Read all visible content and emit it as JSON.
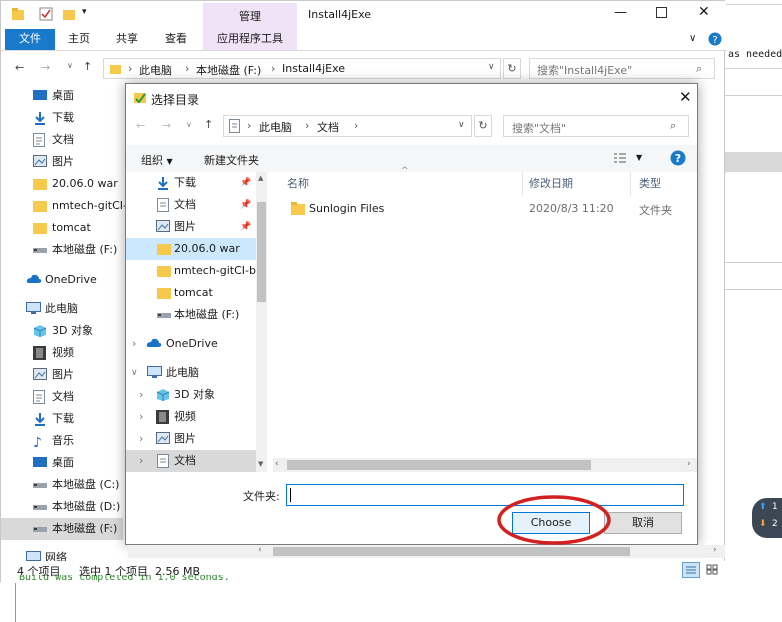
{
  "explorer": {
    "window_title": "Install4jExe",
    "context_tab_group": "管理",
    "ribbon_tabs": [
      "文件",
      "主页",
      "共享",
      "查看",
      "应用程序工具"
    ],
    "address_path": [
      "此电脑",
      "本地磁盘 (F:)",
      "Install4jExe"
    ],
    "search_placeholder": "搜索\"Install4jExe\"",
    "nav_items": [
      {
        "label": "桌面",
        "icon": "desktop-icon"
      },
      {
        "label": "下载",
        "icon": "download-icon"
      },
      {
        "label": "文档",
        "icon": "document-icon"
      },
      {
        "label": "图片",
        "icon": "pictures-icon"
      },
      {
        "label": "20.06.0 war",
        "icon": "folder-icon"
      },
      {
        "label": "nmtech-gitCI-",
        "icon": "folder-icon"
      },
      {
        "label": "tomcat",
        "icon": "folder-icon"
      },
      {
        "label": "本地磁盘 (F:)",
        "icon": "drive-icon"
      },
      {
        "label": "OneDrive",
        "icon": "cloud-icon"
      },
      {
        "label": "此电脑",
        "icon": "computer-icon"
      },
      {
        "label": "3D 对象",
        "icon": "cube-icon"
      },
      {
        "label": "视频",
        "icon": "video-icon"
      },
      {
        "label": "图片",
        "icon": "pictures-icon"
      },
      {
        "label": "文档",
        "icon": "document-icon"
      },
      {
        "label": "下载",
        "icon": "download-icon"
      },
      {
        "label": "音乐",
        "icon": "music-icon"
      },
      {
        "label": "桌面",
        "icon": "desktop-icon"
      },
      {
        "label": "本地磁盘 (C:)",
        "icon": "drive-icon"
      },
      {
        "label": "本地磁盘 (D:)",
        "icon": "drive-icon"
      },
      {
        "label": "本地磁盘 (F:)",
        "icon": "drive-icon"
      },
      {
        "label": "网络",
        "icon": "network-icon"
      }
    ],
    "status_count": "4 个项目",
    "status_selected": "选中 1 个项目  2.56 MB"
  },
  "background": {
    "right_text": "as needed.",
    "bottom_text": "Build was completed in 1.0 seconds.",
    "badge_up": "1",
    "badge_down": "2"
  },
  "dialog": {
    "title": "选择目录",
    "address_path": [
      "此电脑",
      "文档"
    ],
    "search_placeholder": "搜索\"文档\"",
    "organize_label": "组织",
    "new_folder_label": "新建文件夹",
    "nav_items": [
      {
        "label": "下载",
        "icon": "download-icon"
      },
      {
        "label": "文档",
        "icon": "document-icon"
      },
      {
        "label": "图片",
        "icon": "pictures-icon"
      },
      {
        "label": "20.06.0 war",
        "icon": "folder-icon"
      },
      {
        "label": "nmtech-gitCI-b",
        "icon": "folder-icon"
      },
      {
        "label": "tomcat",
        "icon": "folder-icon"
      },
      {
        "label": "本地磁盘 (F:)",
        "icon": "drive-icon"
      },
      {
        "label": "OneDrive",
        "icon": "cloud-icon"
      },
      {
        "label": "此电脑",
        "icon": "computer-icon"
      },
      {
        "label": "3D 对象",
        "icon": "cube-icon"
      },
      {
        "label": "视频",
        "icon": "video-icon"
      },
      {
        "label": "图片",
        "icon": "pictures-icon"
      },
      {
        "label": "文档",
        "icon": "document-icon"
      }
    ],
    "columns": {
      "name": "名称",
      "date": "修改日期",
      "type": "类型"
    },
    "files": [
      {
        "name": "Sunlogin Files",
        "date": "2020/8/3 11:20",
        "type": "文件夹"
      }
    ],
    "filename_label": "文件夹:",
    "filename_value": "",
    "choose_label": "Choose",
    "cancel_label": "取消"
  },
  "colors": {
    "accent": "#0078d7",
    "file_tab": "#1979ca",
    "context_tab": "#f1e3f7",
    "folder": "#f6c94d",
    "annotation_circle": "#d32020"
  }
}
